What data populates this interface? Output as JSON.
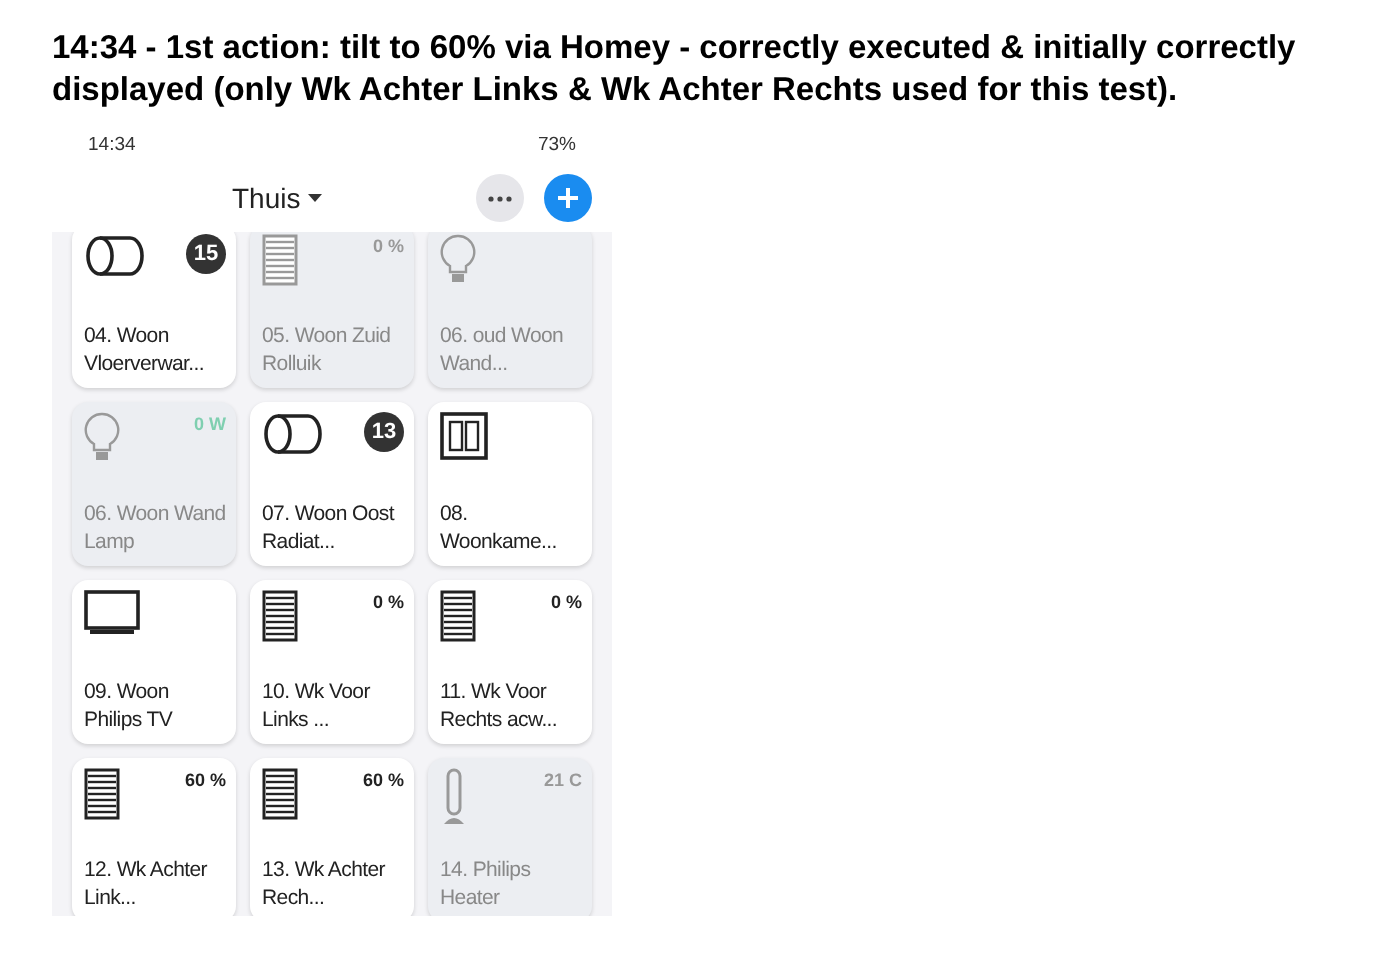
{
  "caption": "14:34 - 1st action: tilt to 60% via Homey - correctly executed & initially correctly displayed (only Wk Achter Links & Wk Achter Rechts used for this test).",
  "status_bar": {
    "time": "14:34",
    "battery": "73%"
  },
  "header": {
    "title": "Thuis"
  },
  "devices": [
    {
      "kind": "radiator",
      "name": "04. Woon Vloerverwar...",
      "on": true,
      "badge": "15"
    },
    {
      "kind": "blind",
      "name": "05. Woon Zuid Rolluik",
      "on": false,
      "value": "0 %"
    },
    {
      "kind": "bulb",
      "name": "06. oud Woon Wand...",
      "on": false
    },
    {
      "kind": "bulb",
      "name": "06. Woon Wand Lamp",
      "on": false,
      "value": "0 W",
      "color": "#7fcfb0"
    },
    {
      "kind": "radiator",
      "name": "07. Woon Oost Radiat...",
      "on": true,
      "badge": "13"
    },
    {
      "kind": "switch",
      "name": "08. Woonkame...",
      "on": true
    },
    {
      "kind": "tv",
      "name": "09. Woon Philips TV",
      "on": true
    },
    {
      "kind": "blind",
      "name": "10. Wk Voor Links ...",
      "on": true,
      "value": "0 %"
    },
    {
      "kind": "blind",
      "name": "11. Wk Voor Rechts acw...",
      "on": true,
      "value": "0 %"
    },
    {
      "kind": "blind",
      "name": "12. Wk Achter Link...",
      "on": true,
      "value": "60 %"
    },
    {
      "kind": "blind",
      "name": "13. Wk Achter Rech...",
      "on": true,
      "value": "60 %"
    },
    {
      "kind": "heater",
      "name": "14. Philips Heater",
      "on": false,
      "value": "21 C"
    }
  ]
}
